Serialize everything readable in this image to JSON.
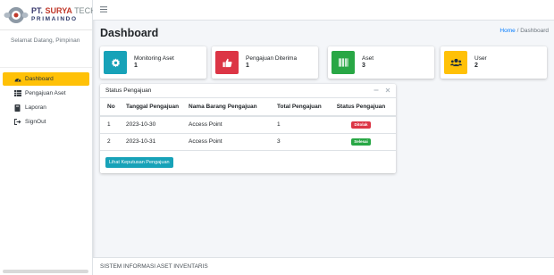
{
  "brand": {
    "pt": "PT.",
    "name": "SURYA",
    "tech": "TECH",
    "subname": "PRIMAINDO"
  },
  "sidebar": {
    "welcome": "Selamat Datang, Pimpinan",
    "items": [
      {
        "label": "Dashboard",
        "icon": "dashboard-icon",
        "active": true
      },
      {
        "label": "Pengajuan Aset",
        "icon": "table-icon",
        "active": false
      },
      {
        "label": "Laporan",
        "icon": "book-icon",
        "active": false
      },
      {
        "label": "SignOut",
        "icon": "sign-out-icon",
        "active": false
      }
    ]
  },
  "topbar": {
    "menu_icon": "hamburger-icon"
  },
  "header": {
    "title": "Dashboard",
    "breadcrumb_home": "Home",
    "breadcrumb_sep": "/",
    "breadcrumb_current": "Dashboard"
  },
  "info_boxes": [
    {
      "label": "Monitoring Aset",
      "value": "1",
      "icon": "gear-icon",
      "color": "#17a2b8"
    },
    {
      "label": "Pengajuan Diterima",
      "value": "1",
      "icon": "thumbs-up-icon",
      "color": "#dc3545"
    },
    {
      "label": "Aset",
      "value": "3",
      "icon": "barcode-icon",
      "color": "#28a745"
    },
    {
      "label": "User",
      "value": "2",
      "icon": "users-icon",
      "color": "#ffc107"
    }
  ],
  "status_card": {
    "title": "Status Pengajuan",
    "collapse_icon": "minus-icon",
    "close_icon": "close-icon",
    "columns": [
      "No",
      "Tanggal Pengajuan",
      "Nama Barang Pengajuan",
      "Total Pengajuan",
      "Status Pengajuan"
    ],
    "rows": [
      {
        "no": "1",
        "date": "2023-10-30",
        "item": "Access Point",
        "total": "1",
        "status": "Ditolak",
        "status_color": "#dc3545"
      },
      {
        "no": "2",
        "date": "2023-10-31",
        "item": "Access Point",
        "total": "3",
        "status": "Selesai",
        "status_color": "#28a745"
      }
    ],
    "button_label": "Lihat Keputusan Pengajuan"
  },
  "footer": {
    "text": "SISTEM INFORMASI ASET INVENTARIS"
  }
}
